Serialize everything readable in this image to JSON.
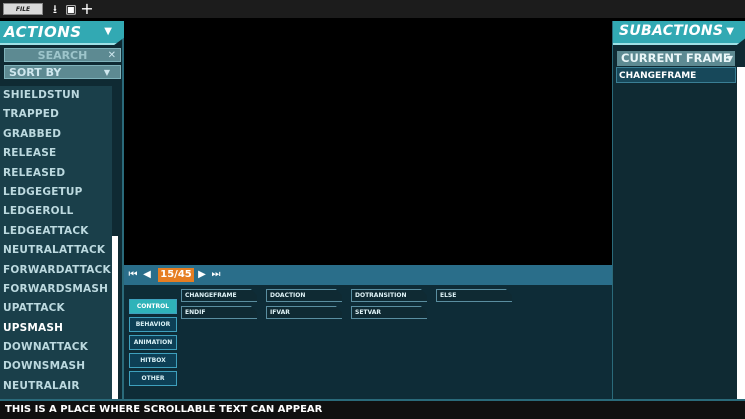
{
  "toolbar": {
    "file_label": "FILE",
    "icons": [
      "download-icon",
      "save-icon",
      "add-icon"
    ],
    "download_glyph": "⭳",
    "save_glyph": "▣",
    "add_glyph": "+"
  },
  "actions": {
    "title": "ACTIONS",
    "search_placeholder": "SEARCH",
    "search_clear": "✕",
    "sort_label": "SORT BY",
    "items": [
      "SHIELDSTUN",
      "TRAPPED",
      "GRABBED",
      "RELEASE",
      "RELEASED",
      "LEDGEGETUP",
      "LEDGEROLL",
      "LEDGEATTACK",
      "NEUTRALATTACK",
      "FORWARDATTACK",
      "FORWARDSMASH",
      "UPATTACK",
      "UPSMASH",
      "DOWNATTACK",
      "DOWNSMASH",
      "NEUTRALAIR"
    ],
    "selected": "UPSMASH"
  },
  "timeline": {
    "frame_counter": "15/45",
    "first": "⏮",
    "prev": "◀",
    "next": "▶",
    "last": "⏭"
  },
  "palette": {
    "categories": [
      "CONTROL",
      "BEHAVIOR",
      "ANIMATION",
      "HITBOX",
      "OTHER"
    ],
    "active_category": "CONTROL",
    "subactions": [
      "CHANGEFRAME",
      "DOACTION",
      "DOTRANSITION",
      "ELSE",
      "ENDIF",
      "IFVAR",
      "SETVAR"
    ]
  },
  "subactions": {
    "title": "SUBACTIONS",
    "frame_select": "CURRENT FRAME",
    "items": [
      "CHANGEFRAME"
    ]
  },
  "status": {
    "text": "THIS IS A PLACE WHERE SCROLLABLE TEXT CAN APPEAR"
  },
  "colors": {
    "accent": "#32a9b3",
    "panel": "#0f2a33",
    "frame_counter": "#e67e22",
    "timeline": "#2a6e8a"
  }
}
